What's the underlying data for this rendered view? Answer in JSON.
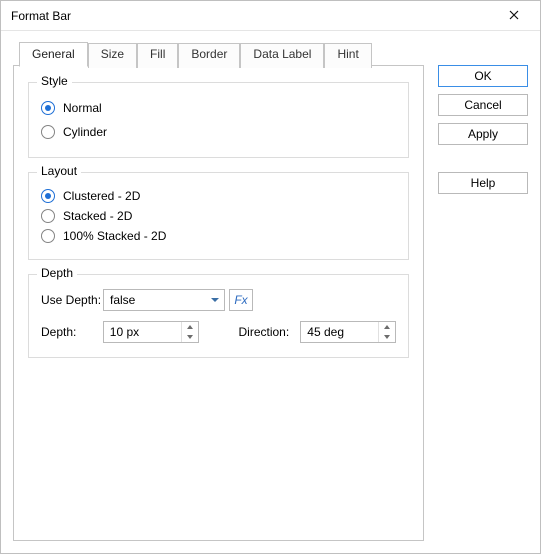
{
  "title": "Format Bar",
  "tabs": [
    {
      "label": "General",
      "active": true
    },
    {
      "label": "Size",
      "active": false
    },
    {
      "label": "Fill",
      "active": false
    },
    {
      "label": "Border",
      "active": false
    },
    {
      "label": "Data Label",
      "active": false
    },
    {
      "label": "Hint",
      "active": false
    }
  ],
  "style_group": {
    "legend": "Style",
    "options": [
      {
        "label": "Normal",
        "checked": true
      },
      {
        "label": "Cylinder",
        "checked": false
      }
    ]
  },
  "layout_group": {
    "legend": "Layout",
    "options": [
      {
        "label": "Clustered - 2D",
        "checked": true
      },
      {
        "label": "Stacked - 2D",
        "checked": false
      },
      {
        "label": "100% Stacked - 2D",
        "checked": false
      }
    ]
  },
  "depth_group": {
    "legend": "Depth",
    "use_depth_label": "Use Depth:",
    "use_depth_value": "false",
    "fx_label": "Fx",
    "depth_label": "Depth:",
    "depth_value": "10 px",
    "direction_label": "Direction:",
    "direction_value": "45 deg"
  },
  "buttons": {
    "ok": "OK",
    "cancel": "Cancel",
    "apply": "Apply",
    "help": "Help"
  }
}
